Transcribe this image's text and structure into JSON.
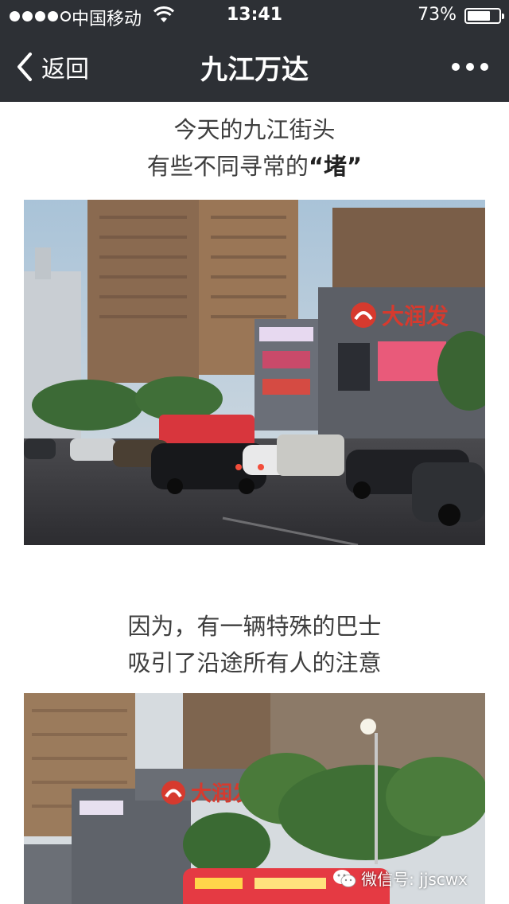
{
  "status_bar": {
    "carrier": "中国移动",
    "time": "13:41",
    "battery_percent": "73%",
    "battery_level": 0.73,
    "signal_bars_filled": 4,
    "signal_bars_total": 5
  },
  "nav": {
    "back_label": "返回",
    "title": "九江万达"
  },
  "article": {
    "caption1_line1": "今天的九江街头",
    "caption1_line2_prefix": "有些不同寻常的",
    "caption1_line2_emph": "“堵”",
    "caption2_line1": "因为，有一辆特殊的巴士",
    "caption2_line2": "吸引了沿途所有人的注意",
    "photo1_sign": "大润发",
    "photo2_sign": "大润发"
  },
  "watermark": {
    "text": "微信号: jjscwx"
  },
  "colors": {
    "nav_bg": "#2d3035",
    "text": "#3e3e3e",
    "sign_red": "#d63a2e"
  }
}
